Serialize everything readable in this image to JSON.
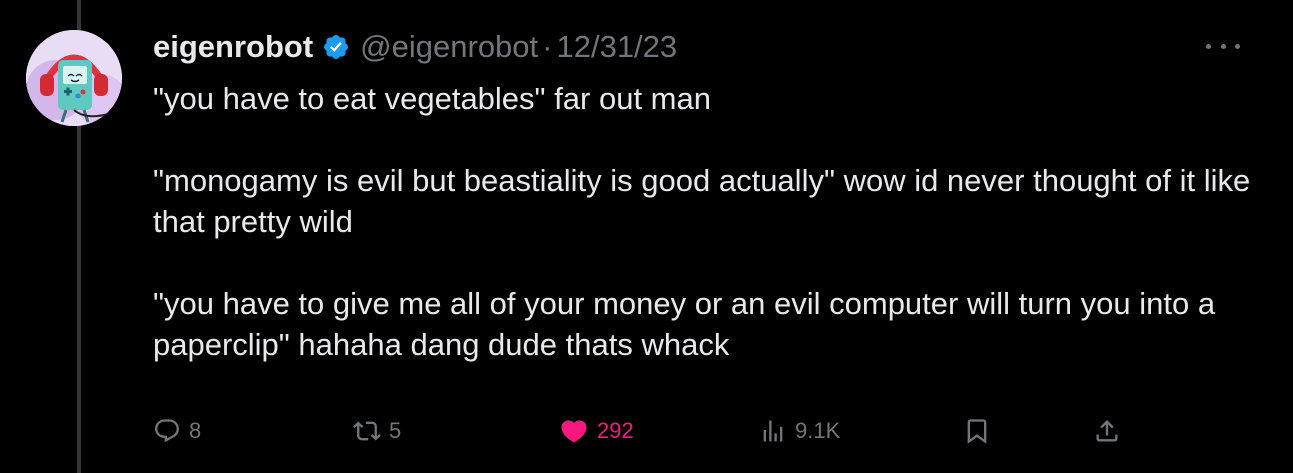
{
  "tweet": {
    "display_name": "eigenrobot",
    "handle": "@eigenrobot",
    "separator": "·",
    "date": "12/31/23",
    "paragraphs": [
      "\"you have to eat vegetables\" far out man",
      "\"monogamy is evil but beastiality is good actually\" wow id never thought of it like that pretty wild",
      "\"you have to give me all of your money or an evil computer will turn you into a paperclip\" hahaha dang dude thats whack"
    ]
  },
  "actions": {
    "replies": "8",
    "reposts": "5",
    "likes": "292",
    "views": "9.1K"
  },
  "icons": {
    "more": "more-options-icon",
    "reply": "reply-icon",
    "repost": "repost-icon",
    "like": "heart-icon",
    "views": "views-icon",
    "bookmark": "bookmark-icon",
    "share": "share-icon",
    "verified": "verified-badge-icon"
  },
  "colors": {
    "background": "#000000",
    "text": "#e7e9ea",
    "muted": "#71767b",
    "like_pink": "#f91880",
    "verified_blue": "#1d9bf0"
  }
}
